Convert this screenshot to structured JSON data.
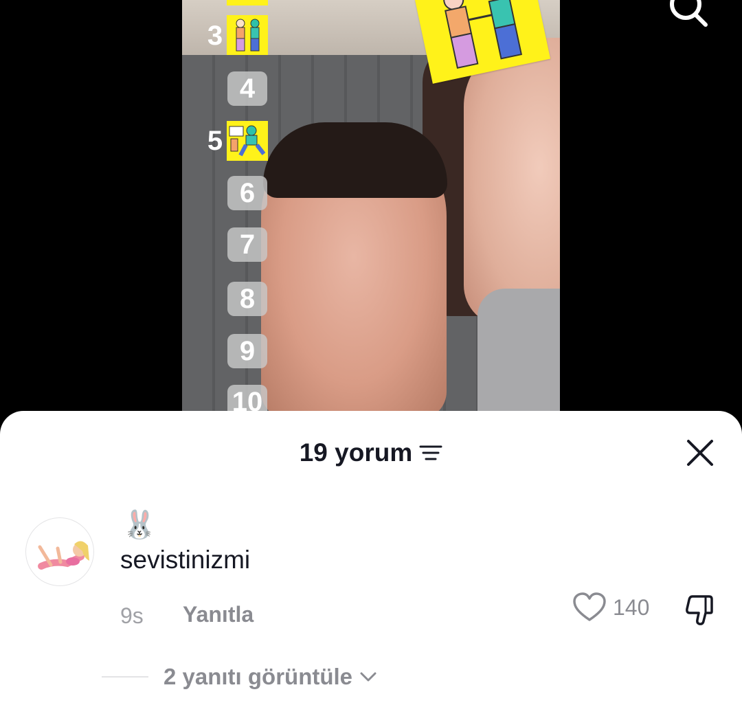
{
  "video": {
    "ranking": {
      "badges": [
        "4",
        "6",
        "7",
        "8",
        "9",
        "10"
      ],
      "picture_ranks": [
        "3",
        "5"
      ]
    }
  },
  "comments_sheet": {
    "title": "19 yorum",
    "comment": {
      "author_emoji": "🐰",
      "text": "sevistinizmi",
      "time": "9s",
      "reply_label": "Yanıtla",
      "like_count": "140",
      "view_replies_label": "2 yanıtı görüntüle"
    }
  },
  "colors": {
    "sheet_background": "#ffffff",
    "primary_text": "#161823",
    "secondary_text": "#8a8b91",
    "sticker_yellow": "#fff21a"
  },
  "icons": [
    "search-icon",
    "sort-icon",
    "close-icon",
    "heart-icon",
    "dislike-icon",
    "chevron-down-icon"
  ]
}
